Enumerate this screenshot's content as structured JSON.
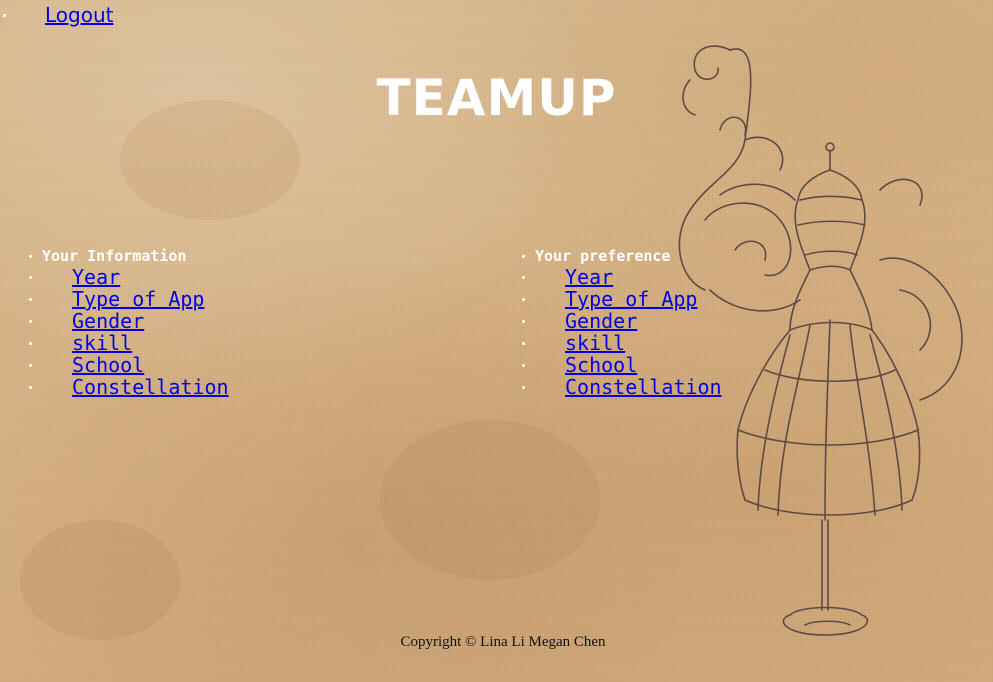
{
  "nav": {
    "logout_label": "Logout"
  },
  "header": {
    "title": "TEAMUP"
  },
  "info": {
    "heading": "Your Information",
    "items": [
      "Year",
      "Type of App",
      "Gender",
      "skill",
      "School",
      "Constellation"
    ]
  },
  "preference": {
    "heading": "Your preference",
    "items": [
      "Year",
      "Type of App",
      "Gender",
      "skill",
      "School",
      "Constellation"
    ]
  },
  "footer": {
    "copyright": "Copyright © Lina Li Megan Chen"
  },
  "colors": {
    "background": "#d7b487",
    "link": "#0000ee",
    "heading_text": "#ffffff",
    "illustration": "#4a3a3e"
  },
  "icons": [
    "mannequin-illustration"
  ]
}
